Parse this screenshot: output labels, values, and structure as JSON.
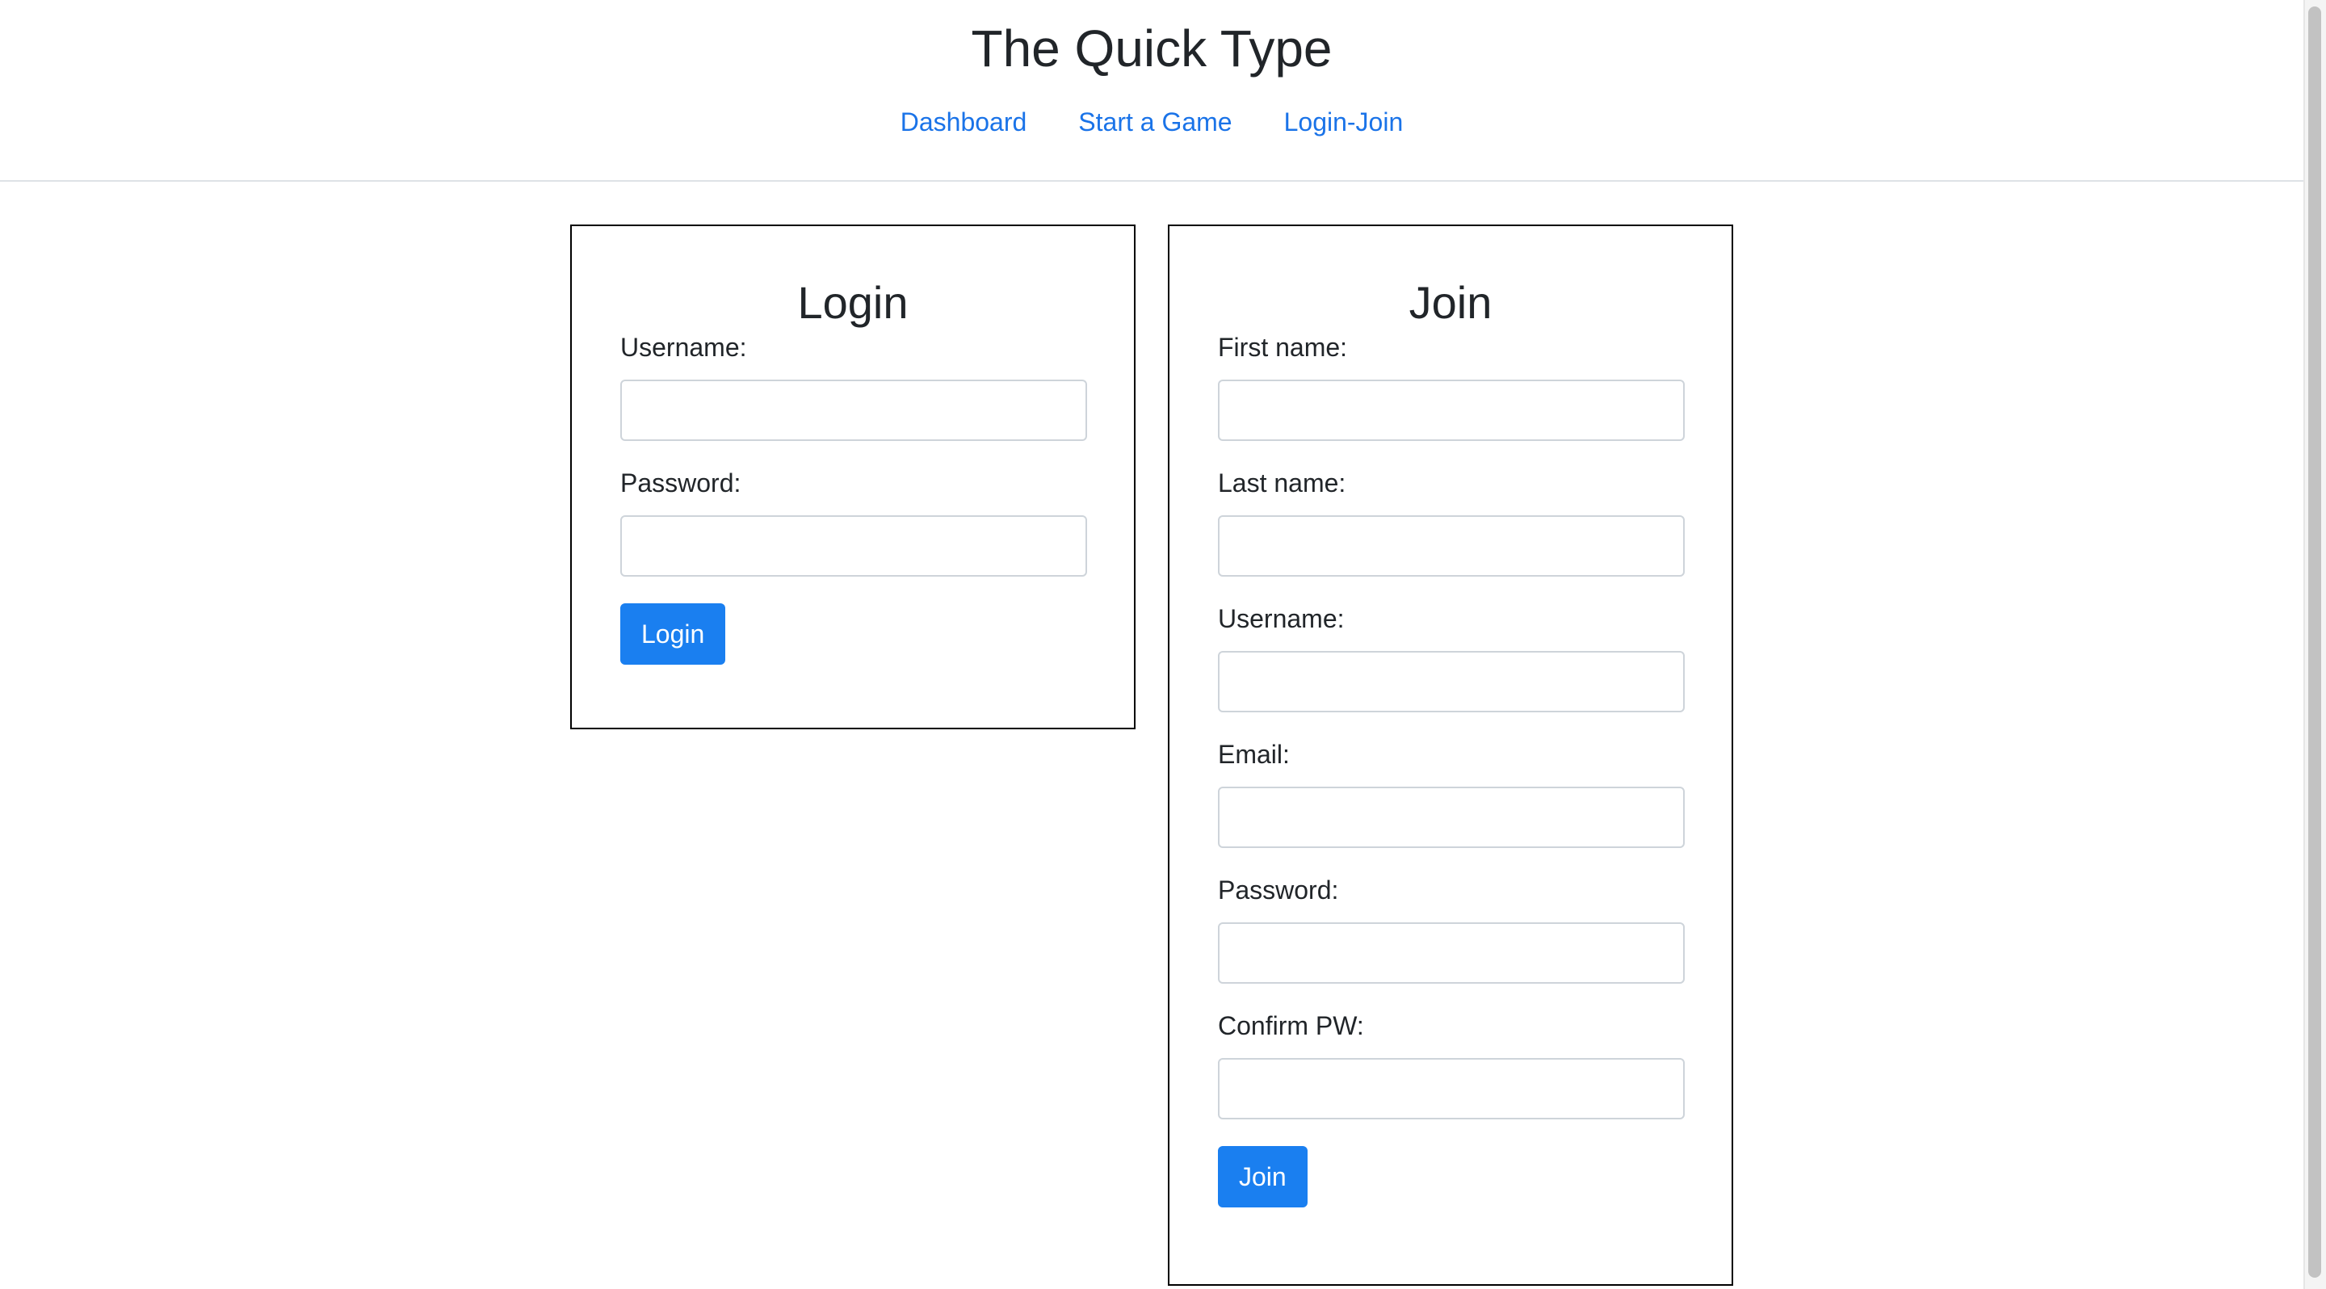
{
  "header": {
    "title": "The Quick Type",
    "nav": [
      {
        "label": "Dashboard"
      },
      {
        "label": "Start a Game"
      },
      {
        "label": "Login-Join"
      }
    ]
  },
  "login": {
    "title": "Login",
    "fields": [
      {
        "label": "Username:",
        "value": ""
      },
      {
        "label": "Password:",
        "value": ""
      }
    ],
    "button": "Login"
  },
  "join": {
    "title": "Join",
    "fields": [
      {
        "label": "First name:",
        "value": ""
      },
      {
        "label": "Last name:",
        "value": ""
      },
      {
        "label": "Username:",
        "value": ""
      },
      {
        "label": "Email:",
        "value": ""
      },
      {
        "label": "Password:",
        "value": ""
      },
      {
        "label": "Confirm PW:",
        "value": ""
      }
    ],
    "button": "Join"
  },
  "colors": {
    "link": "#1a73e8",
    "primary_button": "#1a7ff0",
    "text": "#212529",
    "card_border": "#000000",
    "input_border": "#ced4da"
  }
}
